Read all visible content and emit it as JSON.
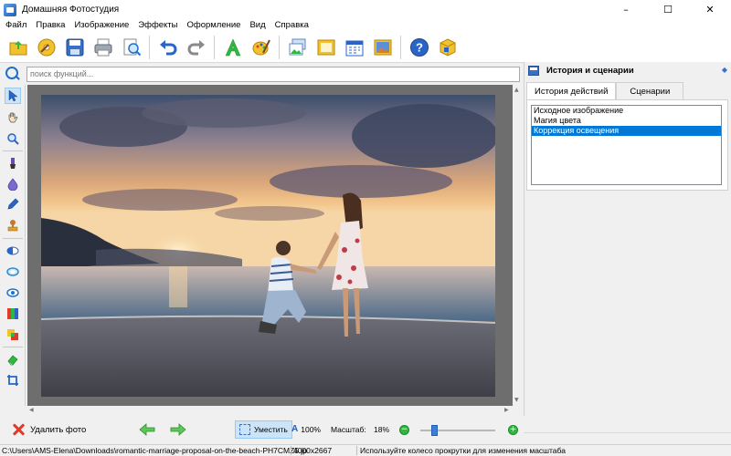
{
  "window": {
    "title": "Домашняя Фотостудия",
    "controls": [
      "–",
      "☐",
      "✕"
    ]
  },
  "menu": [
    "Файл",
    "Правка",
    "Изображение",
    "Эффекты",
    "Оформление",
    "Вид",
    "Справка"
  ],
  "toolbar": {
    "groups": [
      [
        "open-folder-icon",
        "disc-icon",
        "save-icon",
        "print-icon",
        "preview-icon"
      ],
      [
        "undo-icon",
        "redo-icon"
      ],
      [
        "text-icon",
        "palette-icon"
      ],
      [
        "image-icon",
        "frame-icon",
        "calendar-icon",
        "collage-icon"
      ],
      [
        "help-icon",
        "box-icon"
      ]
    ]
  },
  "search": {
    "placeholder": "поиск функций...",
    "value": "поиск функций..."
  },
  "left_tools": [
    "cursor-icon",
    "hand-icon",
    "zoom-icon",
    "brush-icon",
    "drop-icon",
    "pencil-icon",
    "stamp-icon",
    "contrast-icon",
    "ring-icon",
    "eye-icon",
    "levels-icon",
    "color-icon",
    "eraser-icon",
    "crop-icon"
  ],
  "right_panel": {
    "title": "История и сценарии",
    "tabs": [
      "История действий",
      "Сценарии"
    ],
    "active_tab": 0,
    "history": [
      "Исходное изображение",
      "Магия цвета",
      "Коррекция освещения"
    ],
    "selected_index": 2
  },
  "bottom": {
    "delete_label": "Удалить фото",
    "fit_label": "Уместить",
    "zoom_100_label": "100%",
    "scale_label": "Масштаб:",
    "scale_value": "18%",
    "zoom_level": 0.18
  },
  "status": {
    "path": "C:\\Users\\AMS-Elena\\Downloads\\romantic-marriage-proposal-on-the-beach-PH7CMZ5.jp",
    "size": "4000x2667",
    "hint": "Используйте колесо прокрутки для изменения масштаба"
  },
  "colors": {
    "accent": "#0078d7",
    "canvas_bg": "#6e6e6e",
    "delete_red": "#e03a2a",
    "zoom_green": "#2eb83f"
  }
}
